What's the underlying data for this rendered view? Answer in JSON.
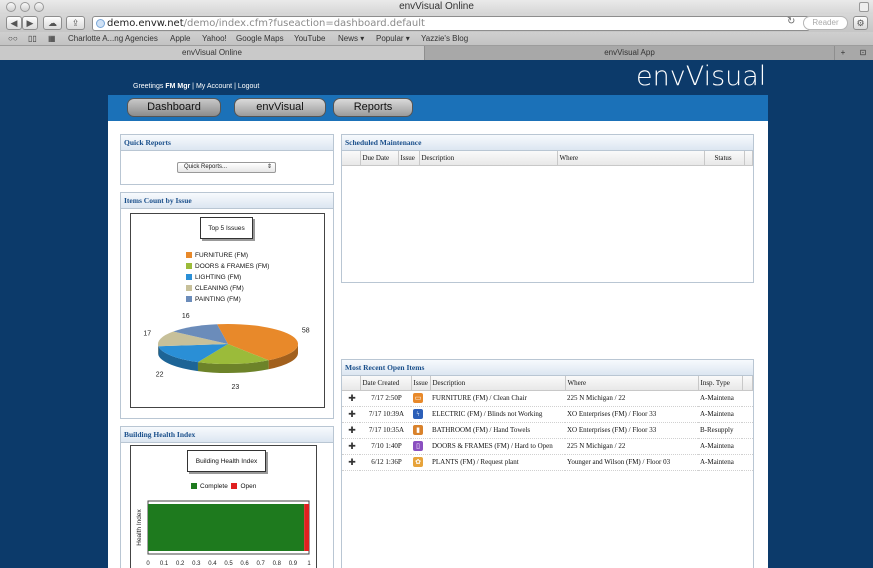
{
  "window": {
    "title": "envVisual Online"
  },
  "toolbar": {
    "url_host": "demo.envw.net",
    "url_path": "/demo/index.cfm?fuseaction=dashboard.default",
    "reader_label": "Reader"
  },
  "bookmarks": [
    "Charlotte A...ng Agencies",
    "Apple",
    "Yahoo!",
    "Google Maps",
    "YouTube",
    "News ▾",
    "Popular ▾",
    "Yazzie's Blog"
  ],
  "tabs": [
    {
      "label": "envVisual Online"
    },
    {
      "label": "envVisual App"
    }
  ],
  "header": {
    "greeting_prefix": "Greetings",
    "user": "FM Mgr",
    "sep1": "|",
    "my_account": "My Account",
    "sep2": "|",
    "logout": "Logout",
    "logo": "envVisual"
  },
  "nav": {
    "dashboard": "Dashboard",
    "envvisual": "envVisual",
    "reports": "Reports"
  },
  "quick_reports": {
    "title": "Quick Reports",
    "select_value": "Quick Reports..."
  },
  "items_count": {
    "title": "Items Count by Issue",
    "chart_title": "Top 5 Issues"
  },
  "building_health": {
    "title": "Building Health Index",
    "chart_title": "Building Health Index",
    "legend_complete": "Complete",
    "legend_open": "Open",
    "ylabel": "Health Index"
  },
  "scheduled": {
    "title": "Scheduled Maintenance",
    "columns": [
      "Due Date",
      "Issue",
      "Description",
      "Where",
      "Status"
    ]
  },
  "recent": {
    "title": "Most Recent Open Items",
    "columns": [
      "Date Created",
      "Issue",
      "Description",
      "Where",
      "Insp. Type"
    ],
    "rows": [
      {
        "date": "7/17 2:50P",
        "desc": "FURNITURE (FM) / Clean Chair",
        "where": "225 N Michigan / 22",
        "type": "A-Maintena",
        "icon": "furniture-icon",
        "color": "#e8892a"
      },
      {
        "date": "7/17 10:39A",
        "desc": "ELECTRIC (FM) / Blinds not Working",
        "where": "XO Enterprises (FM) / Floor 33",
        "type": "A-Maintena",
        "icon": "electric-icon",
        "color": "#2c5fb8"
      },
      {
        "date": "7/17 10:35A",
        "desc": "BATHROOM (FM) / Hand Towels",
        "where": "XO Enterprises (FM) / Floor 33",
        "type": "B-Resupply",
        "icon": "bathroom-icon",
        "color": "#d9822b"
      },
      {
        "date": "7/10 1:40P",
        "desc": "DOORS & FRAMES (FM) / Hard to Open",
        "where": "225 N Michigan / 22",
        "type": "A-Maintena",
        "icon": "doors-icon",
        "color": "#8a4fc0"
      },
      {
        "date": "6/12 1:36P",
        "desc": "PLANTS (FM) / Request plant",
        "where": "Younger and Wilson (FM) / Floor 03",
        "type": "A-Maintena",
        "icon": "plants-icon",
        "color": "#e7a33a"
      }
    ]
  },
  "chart_data": [
    {
      "type": "pie",
      "title": "Top 5 Issues",
      "categories": [
        "FURNITURE (FM)",
        "DOORS & FRAMES (FM)",
        "LIGHTING (FM)",
        "CLEANING (FM)",
        "PAINTING (FM)"
      ],
      "values": [
        58,
        23,
        22,
        17,
        16
      ],
      "colors": [
        "#e8892a",
        "#9bbb3a",
        "#2a8fd6",
        "#c7c09a",
        "#6b8cba"
      ],
      "legend": "top-center"
    },
    {
      "type": "bar",
      "title": "Building Health Index",
      "ylabel": "Health Index",
      "series": [
        {
          "name": "Complete",
          "values": [
            0.97
          ],
          "color": "#1e7a1e"
        },
        {
          "name": "Open",
          "values": [
            0.03
          ],
          "color": "#e02020"
        }
      ],
      "xlim": [
        0,
        1
      ],
      "ticks": [
        "0",
        "0.1",
        "0.2",
        "0.3",
        "0.4",
        "0.5",
        "0.6",
        "0.7",
        "0.8",
        "0.9",
        "1"
      ],
      "orientation": "horizontal"
    }
  ]
}
